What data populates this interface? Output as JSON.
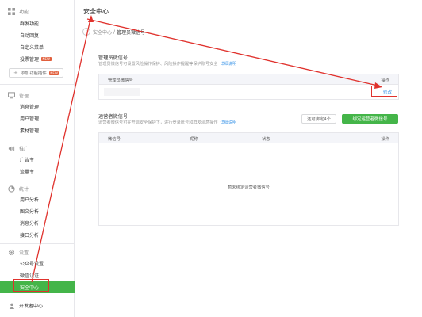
{
  "sidebar": {
    "sections": [
      {
        "title": "功能",
        "icon": "grid-icon",
        "items": [
          {
            "label": "群发功能"
          },
          {
            "label": "自动回复"
          },
          {
            "label": "自定义菜单"
          },
          {
            "label": "投票管理",
            "badge": "NEW"
          }
        ],
        "add_button": {
          "label": "添加功能插件",
          "badge": "NEW"
        }
      },
      {
        "title": "管理",
        "icon": "monitor-icon",
        "items": [
          {
            "label": "消息管理"
          },
          {
            "label": "用户管理"
          },
          {
            "label": "素材管理"
          }
        ]
      },
      {
        "title": "推广",
        "icon": "megaphone-icon",
        "items": [
          {
            "label": "广告主"
          },
          {
            "label": "流量主"
          }
        ]
      },
      {
        "title": "统计",
        "icon": "chart-icon",
        "items": [
          {
            "label": "用户分析"
          },
          {
            "label": "图文分析"
          },
          {
            "label": "消息分析"
          },
          {
            "label": "接口分析"
          }
        ]
      },
      {
        "title": "设置",
        "icon": "gear-icon",
        "items": [
          {
            "label": "公众号设置"
          },
          {
            "label": "微信认证"
          },
          {
            "label": "安全中心",
            "active": true
          }
        ]
      }
    ],
    "developer": {
      "label": "开发者中心",
      "icon": "person-icon"
    }
  },
  "main": {
    "page_title": "安全中心",
    "breadcrumb": {
      "back_icon": "back-icon",
      "parent": "安全中心",
      "separator": "/",
      "current": "管理员微信号"
    },
    "admin": {
      "title": "管理员微信号",
      "desc": "管理员微信号可设置风险操作保护、风险操作提醒等保护账号安全",
      "link": "详细说明",
      "col_wechat": "管理员微信号",
      "col_op": "操作",
      "edit": "修改"
    },
    "operator": {
      "title": "运营者微信号",
      "desc": "运营者微信号可在开启安全保护下，进行登录账号和群发消息操作",
      "link": "详细说明",
      "quota": "还可绑定4个",
      "bind_button": "绑定运营者微信号",
      "columns": [
        "微信号",
        "昵称",
        "状态",
        "操作"
      ],
      "empty": "暂未绑定运营者微信号"
    }
  },
  "colors": {
    "accent": "#44b549",
    "link": "#459ae9",
    "highlight": "#e0322d",
    "badge": "#e15f3c"
  }
}
